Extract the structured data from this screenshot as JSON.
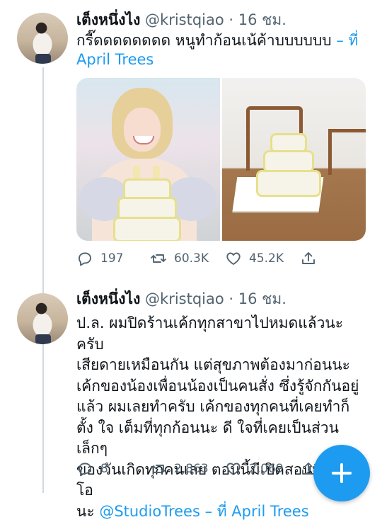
{
  "tweets": [
    {
      "display_name": "เต็งหนึ่งไง",
      "handle_time": "@kristqiao · 16 ชม.",
      "body_lines": [
        "กรี๊ดดดดดดดด หนูทำก้อนเน้ค้าบบบบบบ"
      ],
      "location_line": [
        "– ที่",
        "April Trees"
      ],
      "media_alt": [
        "photo of woman with cake",
        "photo of cake on board"
      ],
      "stats": {
        "replies": "197",
        "retweets": "60.3K",
        "likes": "45.2K"
      }
    },
    {
      "display_name": "เต็งหนึ่งไง",
      "handle_time": "@kristqiao · 16 ชม.",
      "body_lines": [
        "ป.ล. ผมปิดร้านเค้กทุกสาขาไปหมดแล้วนะครับ",
        "เสียดายเหมือนกัน แต่สุขภาพต้องมาก่อนนะ",
        "เค้กของน้องเพื่อนน้องเป็นคนสั่ง ซึ่งรู้จักกันอยู่",
        "แล้ว ผมเลยทำครับ เค้กของทุกคนที่เคยทำก็",
        "ตั้ง ใจ เต็มที่ทุกก้อนนะ ดี ใจที่เคยเป็นส่วนเล็กๆ",
        "ของวันเกิดทุกคนเลย ตอนนี้มีเปิดสอนที่สตูดิ โอ"
      ],
      "last_line": {
        "prefix": "นะ ",
        "mention": "@StudioTrees",
        "suffix": " – ที่ April Trees"
      },
      "stats": {
        "replies": "8",
        "retweets": "2,863",
        "likes": "2,069"
      }
    }
  ],
  "icons": {
    "reply": "reply-icon",
    "retweet": "retweet-icon",
    "like": "heart-icon",
    "share": "share-icon",
    "compose": "plus-icon"
  },
  "colors": {
    "accent": "#1d9bf0",
    "secondary_text": "#536471",
    "line": "#cfd9de"
  }
}
